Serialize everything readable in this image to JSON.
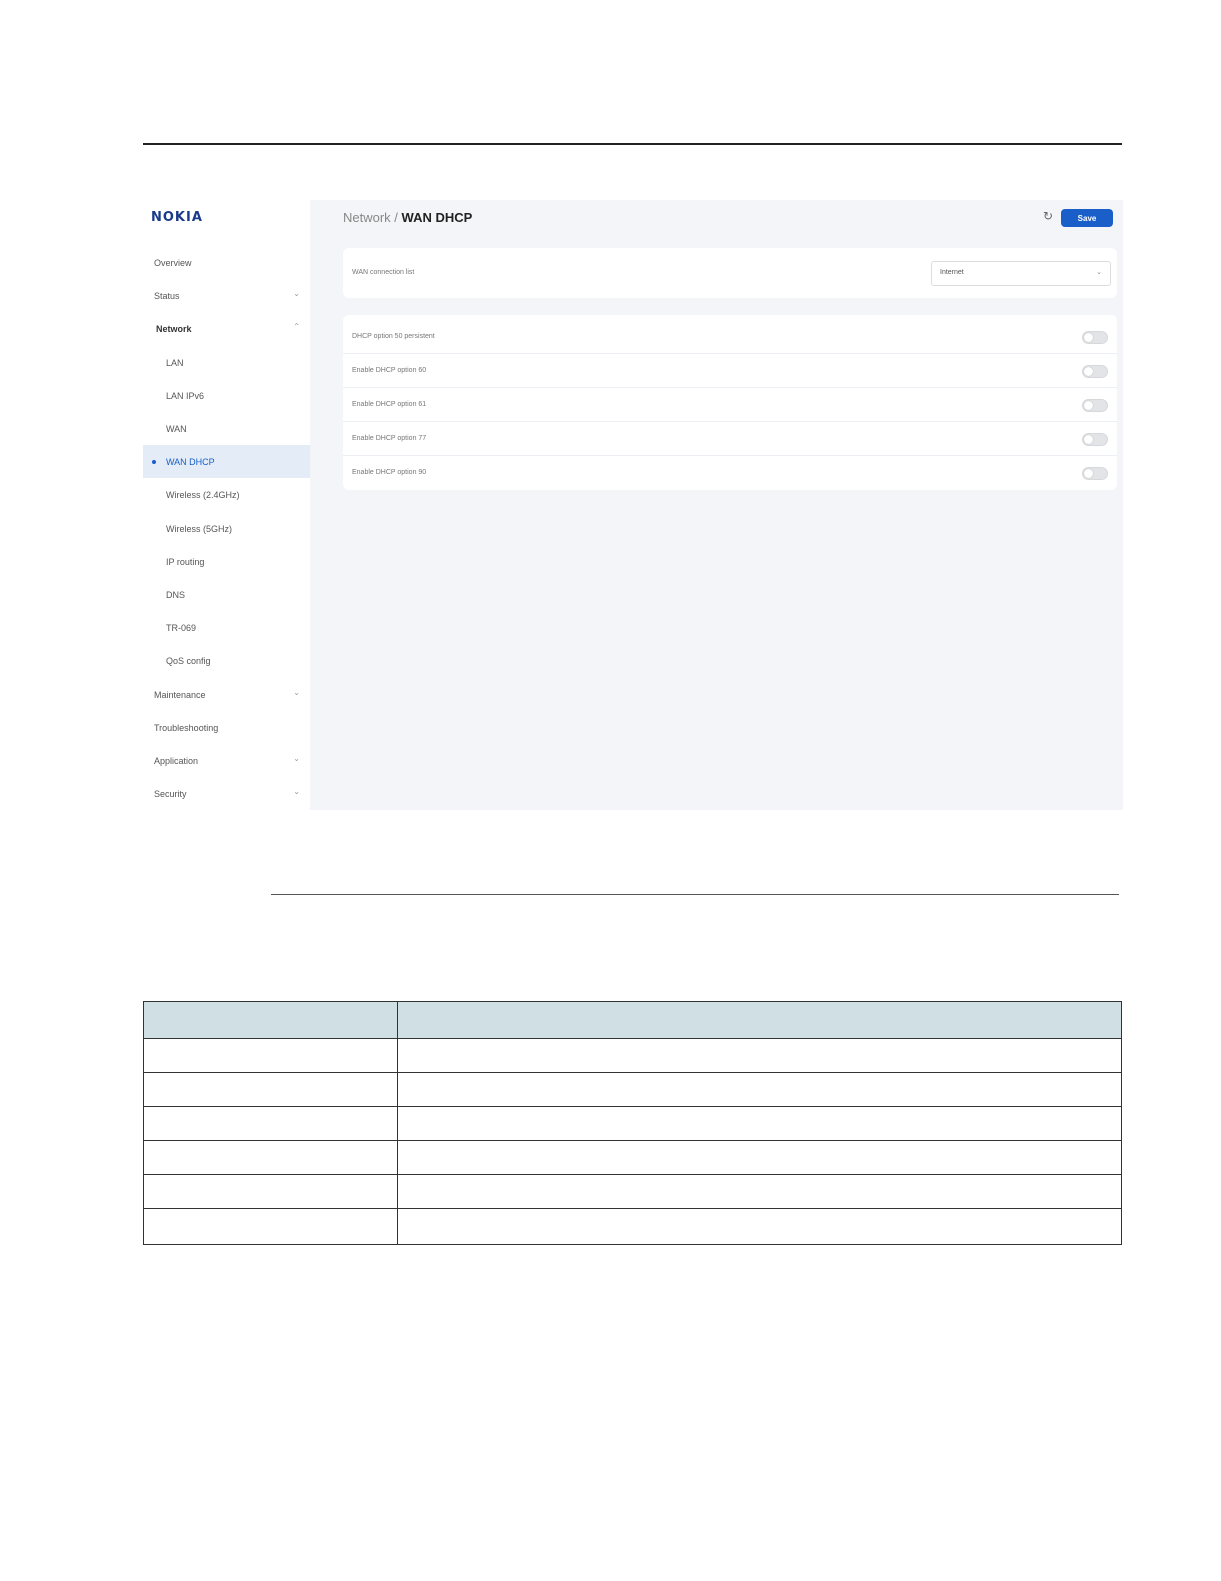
{
  "logo": "NOKIA",
  "sidebar": {
    "items": [
      {
        "label": "Overview",
        "level": "top",
        "chevron": ""
      },
      {
        "label": "Status",
        "level": "top",
        "chevron": "⌄"
      },
      {
        "label": "Network",
        "level": "bold",
        "chevron": "⌃"
      },
      {
        "label": "LAN",
        "level": "sub",
        "chevron": ""
      },
      {
        "label": "LAN IPv6",
        "level": "sub",
        "chevron": ""
      },
      {
        "label": "WAN",
        "level": "sub",
        "chevron": ""
      },
      {
        "label": "WAN DHCP",
        "level": "sub",
        "chevron": "",
        "active": true
      },
      {
        "label": "Wireless (2.4GHz)",
        "level": "sub",
        "chevron": ""
      },
      {
        "label": "Wireless (5GHz)",
        "level": "sub",
        "chevron": ""
      },
      {
        "label": "IP routing",
        "level": "sub",
        "chevron": ""
      },
      {
        "label": "DNS",
        "level": "sub",
        "chevron": ""
      },
      {
        "label": "TR-069",
        "level": "sub",
        "chevron": ""
      },
      {
        "label": "QoS config",
        "level": "sub",
        "chevron": ""
      },
      {
        "label": "Maintenance",
        "level": "top",
        "chevron": "⌄"
      },
      {
        "label": "Troubleshooting",
        "level": "top",
        "chevron": ""
      },
      {
        "label": "Application",
        "level": "top",
        "chevron": "⌄"
      },
      {
        "label": "Security",
        "level": "top",
        "chevron": "⌄"
      }
    ]
  },
  "header": {
    "breadcrumb_parent": "Network / ",
    "breadcrumb_current": "WAN DHCP",
    "refresh_icon": "↻",
    "save_label": "Save"
  },
  "wan_connection": {
    "label": "WAN connection list",
    "selected": "Internet",
    "chevron": "⌄"
  },
  "dhcp_options": [
    {
      "label": "DHCP option 50 persistent",
      "enabled": false
    },
    {
      "label": "Enable DHCP option 60",
      "enabled": false
    },
    {
      "label": "Enable DHCP option 61",
      "enabled": false
    },
    {
      "label": "Enable DHCP option 77",
      "enabled": false
    },
    {
      "label": "Enable DHCP option 90",
      "enabled": false
    }
  ],
  "colors": {
    "accent": "#1a5fc9",
    "table_header": "#cfdfe4"
  }
}
